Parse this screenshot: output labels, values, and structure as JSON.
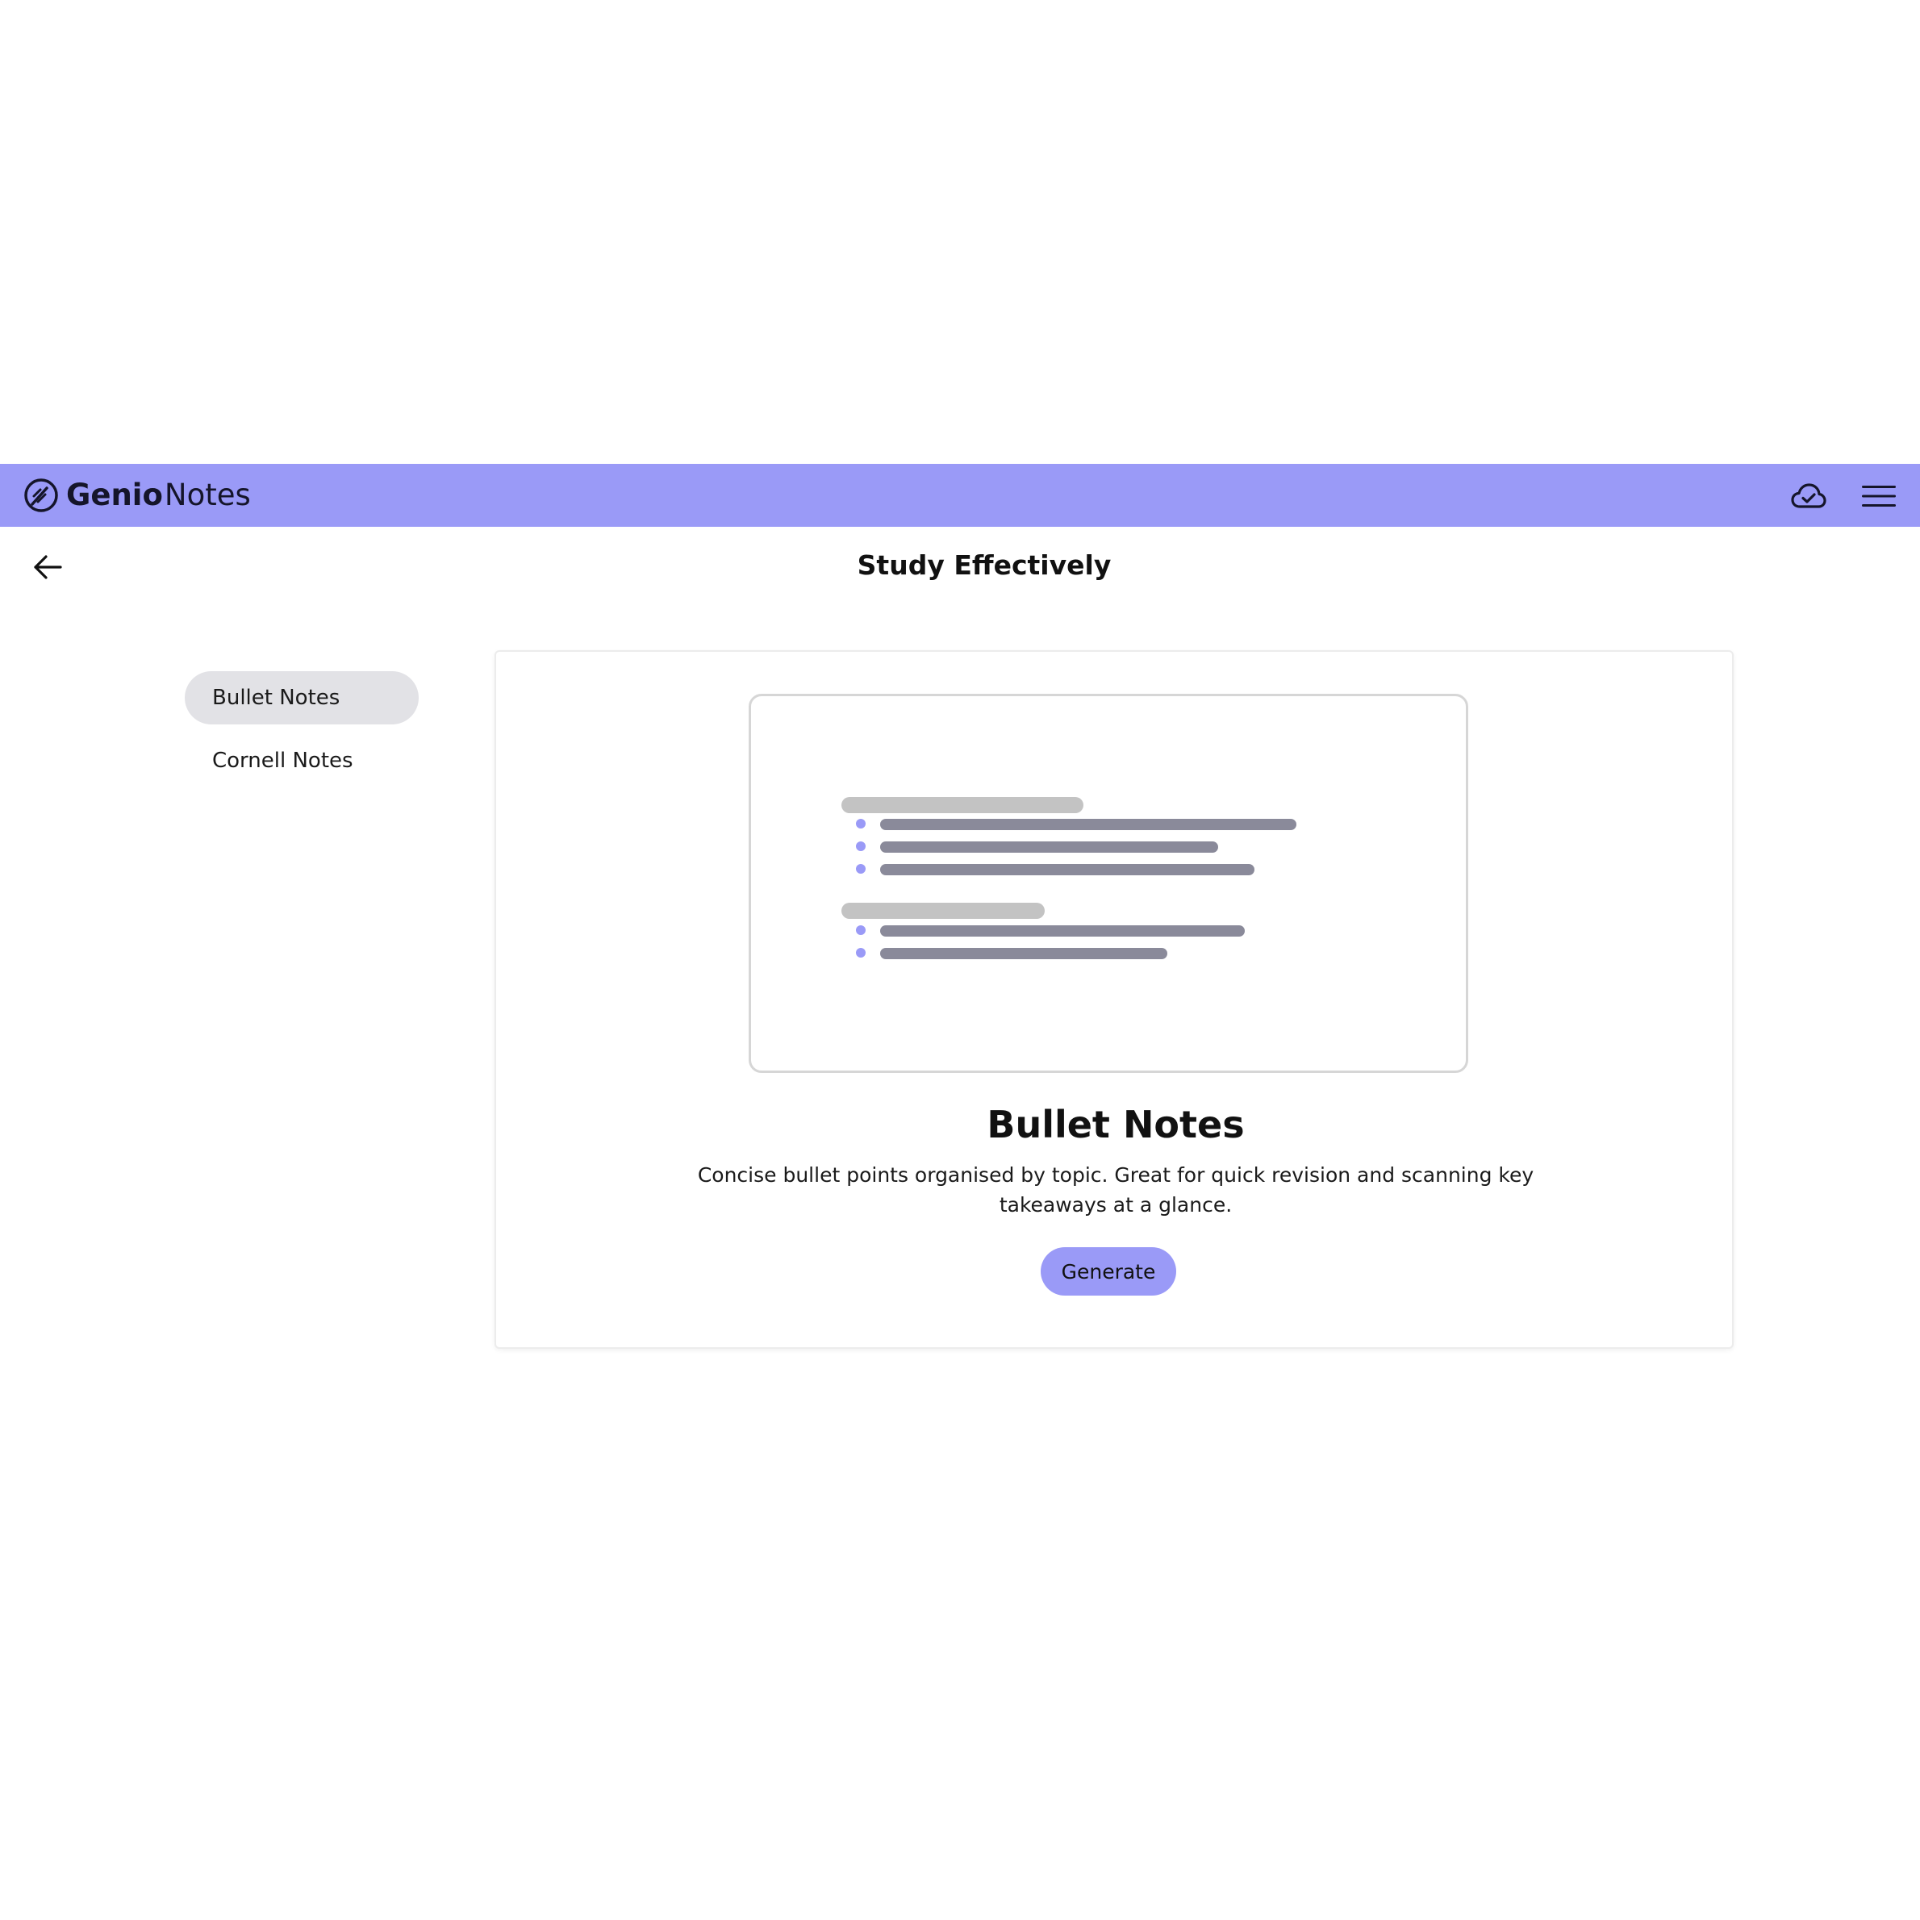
{
  "app": {
    "brand_bold": "Genio",
    "brand_light": "Notes",
    "accent_color": "#9a9af7"
  },
  "header": {
    "title": "Study Effectively",
    "back_icon": "arrow-left-icon",
    "sync_icon": "cloud-check-icon",
    "menu_icon": "hamburger-menu-icon"
  },
  "sidebar": {
    "items": [
      {
        "label": "Bullet Notes",
        "active": true
      },
      {
        "label": "Cornell Notes",
        "active": false
      }
    ]
  },
  "main": {
    "title": "Bullet Notes",
    "description": "Concise bullet points organised by topic. Great for quick revision and scanning key takeaways at a glance.",
    "generate_label": "Generate"
  }
}
